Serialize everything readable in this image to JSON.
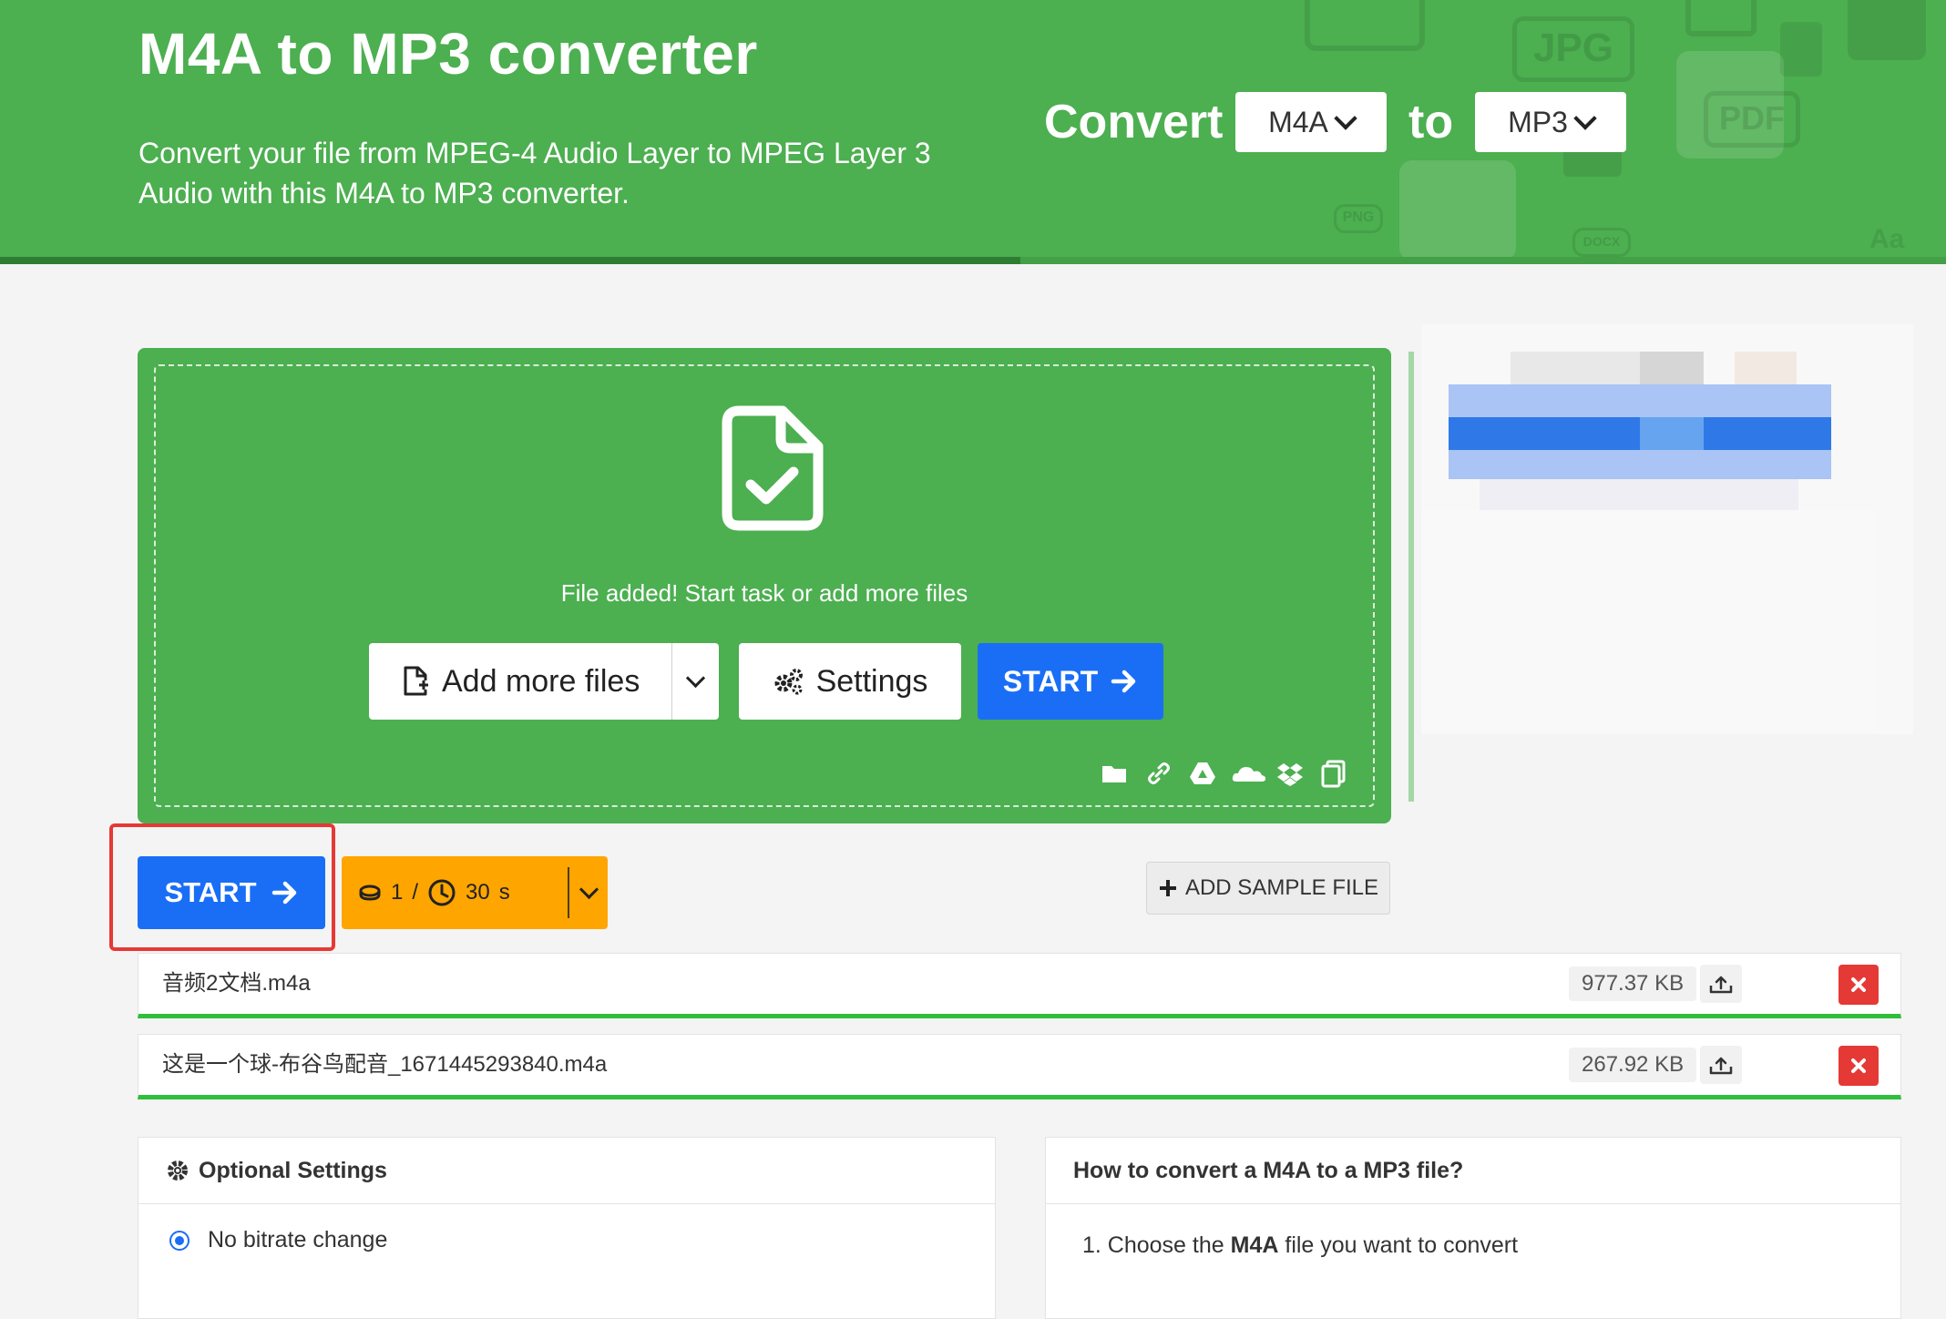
{
  "header": {
    "title": "M4A to MP3 converter",
    "subtitle": "Convert your file from MPEG-4 Audio Layer to MPEG Layer 3 Audio with this M4A to MP3 converter.",
    "convert_label": "Convert",
    "to_label": "to",
    "from_format": "M4A",
    "to_format": "MP3",
    "bg_labels": [
      "JPG",
      "PDF",
      "PNG",
      "DOCX",
      "Aa"
    ]
  },
  "upload": {
    "status": "File added! Start task or add more files",
    "add_more_label": "Add more files",
    "settings_label": "Settings",
    "start_label": "START",
    "sources": [
      "folder-icon",
      "link-icon",
      "google-drive-icon",
      "onedrive-icon",
      "dropbox-icon",
      "clipboard-icon"
    ]
  },
  "actions": {
    "start_label": "START",
    "credits": "1",
    "credits_sep": "/",
    "time": "30",
    "time_unit": "s",
    "add_sample_label": "ADD SAMPLE FILE"
  },
  "files": [
    {
      "name": "音频2文档.m4a",
      "size": "977.37 KB"
    },
    {
      "name": "这是一个球-布谷鸟配音_1671445293840.m4a",
      "size": "267.92 KB"
    }
  ],
  "optional_settings": {
    "title": "Optional Settings",
    "option_label": "No bitrate change"
  },
  "howto": {
    "title": "How to convert a M4A to a MP3 file?",
    "step1_prefix": "1. Choose the ",
    "step1_bold": "M4A",
    "step1_suffix": " file you want to convert"
  },
  "colors": {
    "brand_green": "#4caf50",
    "primary_blue": "#1a6ef5",
    "credits_orange": "#ffa500",
    "danger_red": "#e53935",
    "progress_green": "#2fbf3a"
  }
}
